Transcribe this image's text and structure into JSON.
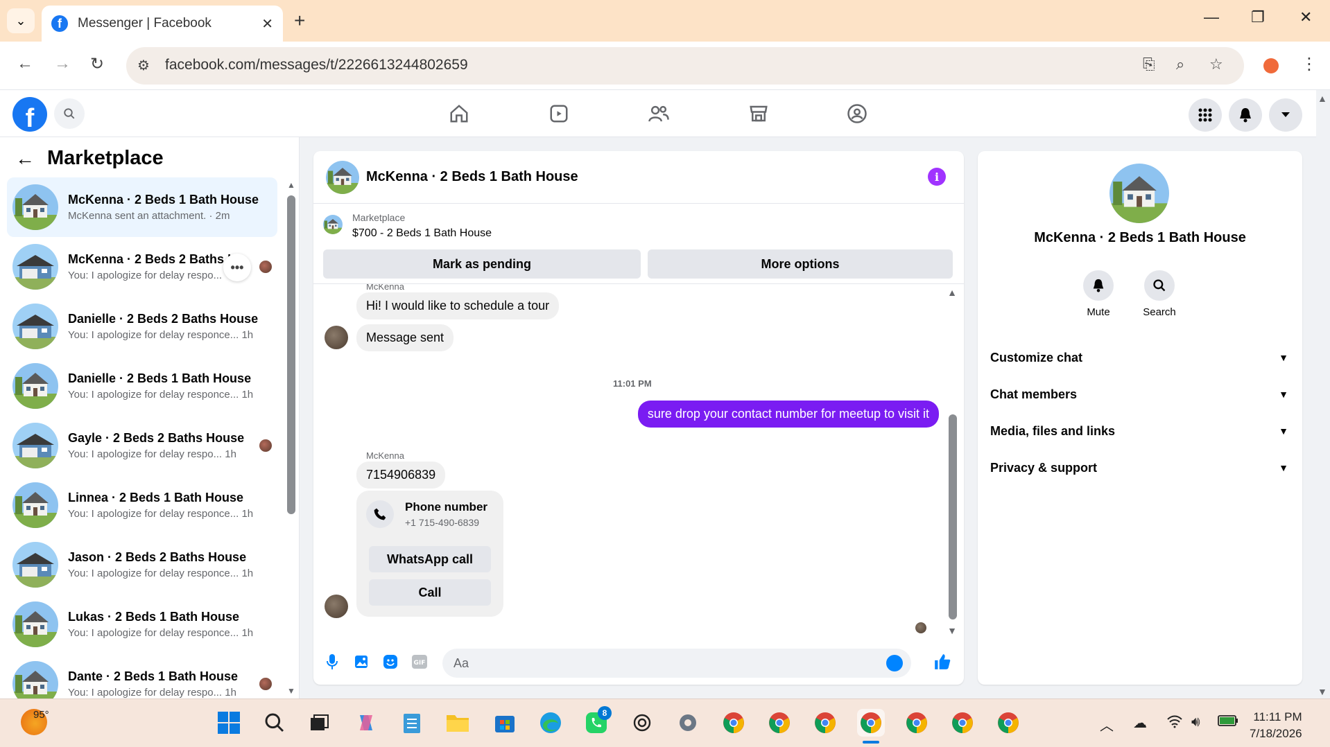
{
  "browser": {
    "tab_title": "Messenger | Facebook",
    "url": "facebook.com/messages/t/2226613244802659"
  },
  "sidebar": {
    "title": "Marketplace",
    "conversations": [
      {
        "name": "McKenna · 2 Beds 1 Bath House",
        "preview": "McKenna sent an attachment. · 2m",
        "active": true,
        "house": "white"
      },
      {
        "name": "McKenna · 2 Beds 2 Baths H",
        "preview": "You: I apologize for delay respo...",
        "active": false,
        "house": "blue"
      },
      {
        "name": "Danielle · 2 Beds 2 Baths House",
        "preview": "You: I apologize for delay responce... 1h",
        "active": false,
        "house": "blue"
      },
      {
        "name": "Danielle · 2 Beds 1 Bath House",
        "preview": "You: I apologize for delay responce... 1h",
        "active": false,
        "house": "white"
      },
      {
        "name": "Gayle · 2 Beds 2 Baths House",
        "preview": "You: I apologize for delay respo...  1h",
        "active": false,
        "house": "blue"
      },
      {
        "name": "Linnea · 2 Beds 1 Bath House",
        "preview": "You: I apologize for delay responce... 1h",
        "active": false,
        "house": "white"
      },
      {
        "name": "Jason · 2 Beds 2 Baths House",
        "preview": "You: I apologize for delay responce... 1h",
        "active": false,
        "house": "blue"
      },
      {
        "name": "Lukas · 2 Beds 1 Bath House",
        "preview": "You: I apologize for delay responce... 1h",
        "active": false,
        "house": "white"
      },
      {
        "name": "Dante · 2 Beds 1 Bath House",
        "preview": "You: I apologize for delay respo...  1h",
        "active": false,
        "house": "white"
      }
    ]
  },
  "chat": {
    "title": "McKenna · 2 Beds 1 Bath House",
    "marketplace_label": "Marketplace",
    "listing": "$700 - 2 Beds 1 Bath House",
    "mark_pending": "Mark as pending",
    "more_options": "More options",
    "sender_top": "McKenna",
    "msg1": "Hi! I would like to schedule a tour",
    "msg2": "Message sent",
    "timestamp": "11:01 PM",
    "outgoing": "sure drop your contact number for meetup to visit it",
    "sender_mid": "McKenna",
    "msg3": "7154906839",
    "phone_card_title": "Phone number",
    "phone_card_number": "+1 715-490-6839",
    "whatsapp_call": "WhatsApp call",
    "call": "Call",
    "composer_placeholder": "Aa"
  },
  "details": {
    "name": "McKenna · 2 Beds 1 Bath House",
    "mute": "Mute",
    "search": "Search",
    "sections": [
      "Customize chat",
      "Chat members",
      "Media, files and links",
      "Privacy & support"
    ]
  },
  "taskbar": {
    "temperature": "95°",
    "whatsapp_badge": "8",
    "time": "11:11 PM",
    "date": "7/18/2026"
  },
  "colors": {
    "fb_blue": "#1877f2",
    "outgoing_bubble": "#7a1cf2",
    "active_conversation": "#ebf5ff"
  }
}
